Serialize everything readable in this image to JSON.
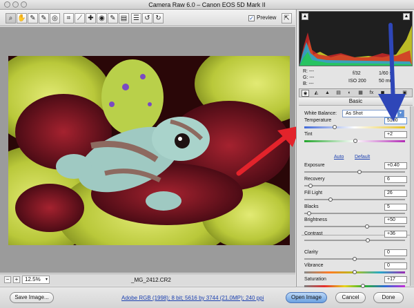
{
  "window": {
    "title": "Camera Raw 6.0  –  Canon EOS 5D Mark II"
  },
  "toolbar": {
    "tools": [
      {
        "name": "zoom-tool-icon",
        "glyph": "⌕"
      },
      {
        "name": "hand-tool-icon",
        "glyph": "✋"
      },
      {
        "name": "white-balance-tool-icon",
        "glyph": "✎"
      },
      {
        "name": "color-sampler-tool-icon",
        "glyph": "✎"
      },
      {
        "name": "targeted-adjustment-tool-icon",
        "glyph": "◎"
      },
      {
        "name": "crop-tool-icon",
        "glyph": "⌗"
      },
      {
        "name": "straighten-tool-icon",
        "glyph": "⟋"
      },
      {
        "name": "spot-removal-tool-icon",
        "glyph": "✚"
      },
      {
        "name": "red-eye-tool-icon",
        "glyph": "◉"
      },
      {
        "name": "adjustment-brush-tool-icon",
        "glyph": "✎"
      },
      {
        "name": "graduated-filter-tool-icon",
        "glyph": "▤"
      },
      {
        "name": "preferences-icon",
        "glyph": "☰"
      },
      {
        "name": "rotate-ccw-icon",
        "glyph": "↺"
      },
      {
        "name": "rotate-cw-icon",
        "glyph": "↻"
      }
    ],
    "preview_label": "Preview",
    "preview_checked": true,
    "fullscreen_glyph": "⇱"
  },
  "status": {
    "zoom_minus": "−",
    "zoom_plus": "+",
    "zoom_value": "12.5%",
    "filename": "_MG_2412.CR2"
  },
  "bottom": {
    "save_label": "Save Image...",
    "workflow_link": "Adobe RGB (1998); 8 bit; 5616 by 3744 (21.0MP); 240 ppi",
    "open_label": "Open Image",
    "cancel_label": "Cancel",
    "done_label": "Done"
  },
  "info": {
    "r": "R:  ---",
    "g": "G:  ---",
    "b": "B:  ---",
    "aperture": "f/32",
    "shutter": "1/60 s",
    "iso": "ISO 200",
    "focal": "50 mm"
  },
  "panel": {
    "tab_glyphs": [
      "◉",
      "◭",
      "▲",
      "▤",
      "◐",
      "▦",
      "fx",
      "◼",
      "≡",
      "▣"
    ],
    "active_tab": 0,
    "title": "Basic",
    "white_balance_label": "White Balance:",
    "white_balance_value": "As Shot",
    "auto_label": "Auto",
    "default_label": "Default",
    "sliders": [
      {
        "key": "temp",
        "label": "Temperature",
        "value": "5100",
        "pos": 0.3,
        "track": "temp"
      },
      {
        "key": "tint",
        "label": "Tint",
        "value": "+2",
        "pos": 0.51,
        "track": "tint"
      },
      {
        "key": "exposure",
        "label": "Exposure",
        "value": "+0.40",
        "pos": 0.55,
        "track": "plain"
      },
      {
        "key": "recovery",
        "label": "Recovery",
        "value": "6",
        "pos": 0.06,
        "track": "plain"
      },
      {
        "key": "fill",
        "label": "Fill Light",
        "value": "26",
        "pos": 0.26,
        "track": "plain"
      },
      {
        "key": "blacks",
        "label": "Blacks",
        "value": "5",
        "pos": 0.05,
        "track": "plain"
      },
      {
        "key": "brightness",
        "label": "Brightness",
        "value": "+50",
        "pos": 0.62,
        "track": "plain"
      },
      {
        "key": "contrast",
        "label": "Contrast",
        "value": "+36",
        "pos": 0.63,
        "track": "plain"
      },
      {
        "key": "clarity",
        "label": "Clarity",
        "value": "0",
        "pos": 0.5,
        "track": "plain"
      },
      {
        "key": "vibrance",
        "label": "Vibrance",
        "value": "0",
        "pos": 0.5,
        "track": "vib"
      },
      {
        "key": "saturation",
        "label": "Saturation",
        "value": "+17",
        "pos": 0.58,
        "track": "sat"
      }
    ]
  },
  "colors": {
    "annotation_red": "#e3232b",
    "annotation_blue": "#2e46b8",
    "accent_blue": "#5c8fd6"
  }
}
